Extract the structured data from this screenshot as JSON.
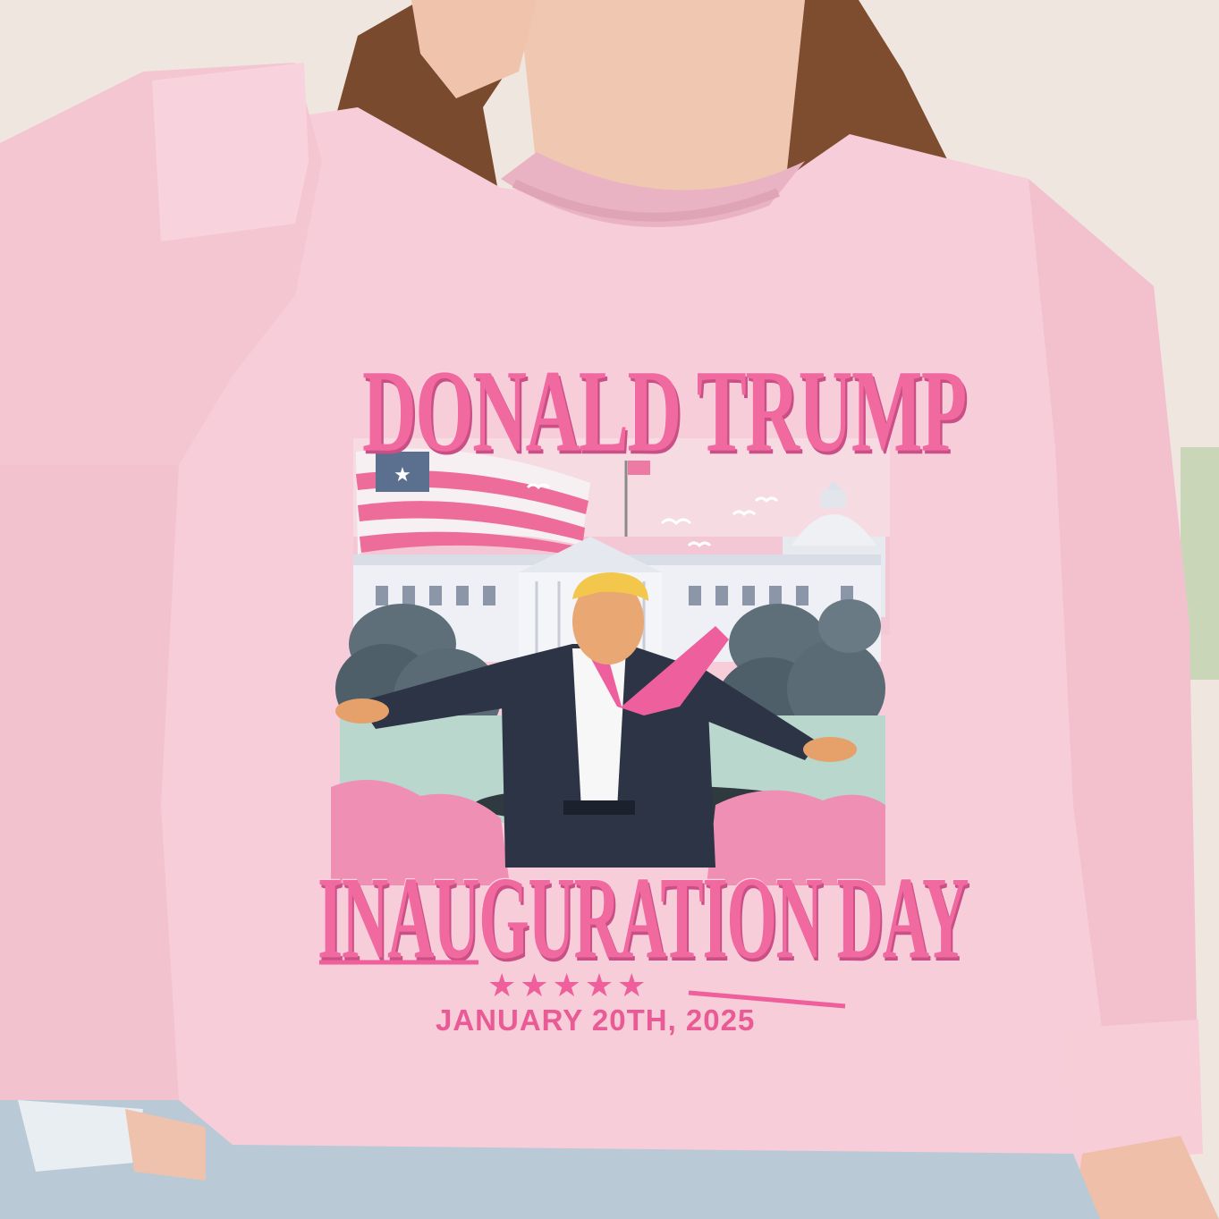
{
  "design": {
    "title_top": "DONALD TRUMP",
    "title_bottom": "INAUGURATION DAY",
    "date": "JANUARY 20TH, 2025",
    "stars": "★★★★★"
  },
  "colors": {
    "sweatshirt": "#f6cdd8",
    "accent_pink": "#f06aa0",
    "background_wall": "#efe6df",
    "hair": "#7a4a2e",
    "jeans": "#b9c9d6"
  },
  "icons": [
    "us-flag-icon",
    "capitol-dome-icon",
    "white-house-icon",
    "star-icon"
  ]
}
